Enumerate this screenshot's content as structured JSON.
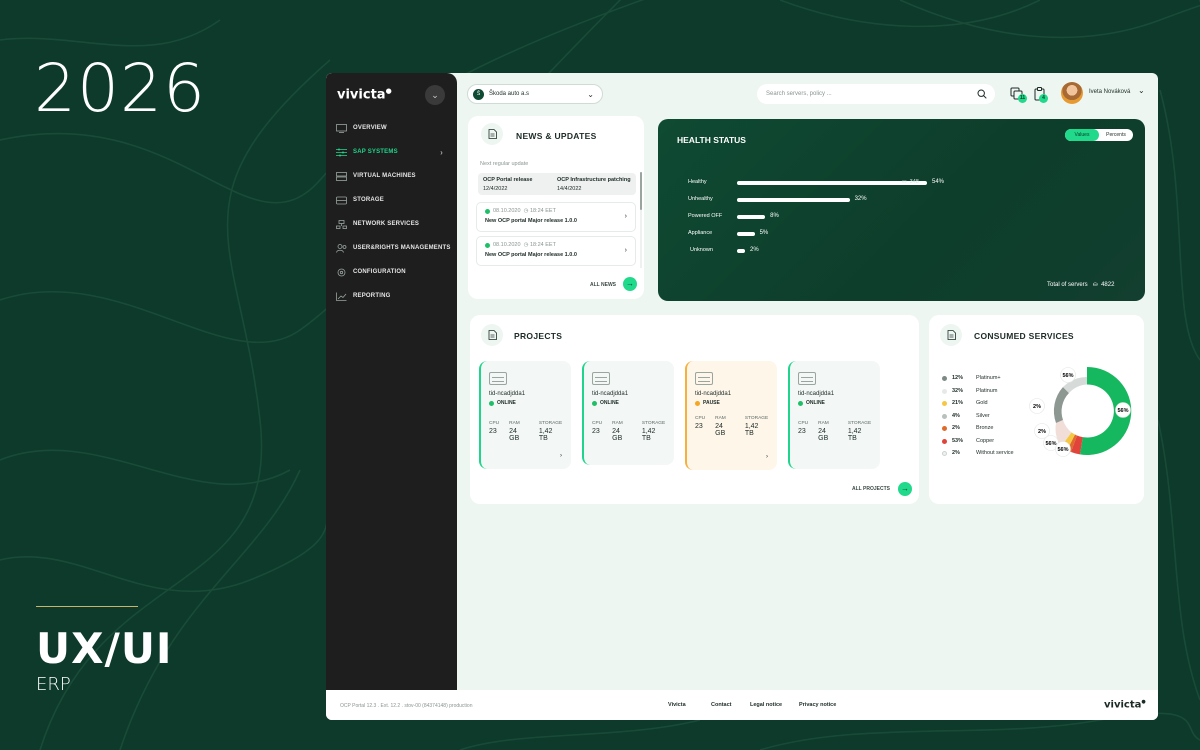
{
  "promo": {
    "year": "2026",
    "title": "UX/UI",
    "subtitle": "ERP"
  },
  "app": {
    "logo": "vivicta",
    "sidebar": {
      "items": [
        {
          "label": "OVERVIEW",
          "icon": "monitor-icon"
        },
        {
          "label": "SAP SYSTEMS",
          "icon": "sliders-icon",
          "active": true
        },
        {
          "label": "VIRTUAL MACHINES",
          "icon": "server-icon"
        },
        {
          "label": "STORAGE",
          "icon": "storage-icon"
        },
        {
          "label": "NETWORK SERVICES",
          "icon": "network-icon"
        },
        {
          "label": "USER&RIGHTS MANAGEMENTS",
          "icon": "users-icon"
        },
        {
          "label": "CONFIGURATION",
          "icon": "gear-icon"
        },
        {
          "label": "REPORTING",
          "icon": "chart-icon"
        }
      ]
    },
    "topbar": {
      "company": "Škoda auto a.s",
      "search_placeholder": "Search servers, policy ...",
      "notif_badge_1": "11",
      "notif_badge_2": "4",
      "user_name": "Iveta Nováková"
    },
    "news": {
      "title": "NEWS & UPDATES",
      "subtitle": "Next regular update",
      "tabs": [
        {
          "title": "OCP Portal release",
          "date": "12/4/2022"
        },
        {
          "title": "OCP Infrastructure patching",
          "date": "14/4/2022"
        }
      ],
      "items": [
        {
          "date": "08.10.2020",
          "time": "18:24 EET",
          "title": "New OCP portal Major release 1.0.0"
        },
        {
          "date": "08.10.2020",
          "time": "18:24 EET",
          "title": "New OCP portal Major release 1.0.0"
        }
      ],
      "all_link": "ALL NEWS"
    },
    "health": {
      "title": "HEALTH STATUS",
      "toggle": {
        "values": "Values",
        "percents": "Percents",
        "selected": "Values"
      },
      "rows": [
        {
          "label": "Healthy",
          "percent": 54,
          "percent_label": "54%",
          "servers": "348"
        },
        {
          "label": "Unhealthy",
          "percent": 32,
          "percent_label": "32%"
        },
        {
          "label": "Powered OFF",
          "percent": 8,
          "percent_label": "8%"
        },
        {
          "label": "Appliance",
          "percent": 5,
          "percent_label": "5%"
        },
        {
          "label": "Unknown",
          "percent": 2,
          "percent_label": "2%"
        }
      ],
      "total_label": "Total of servers",
      "total_value": "4822"
    },
    "projects": {
      "title": "PROJECTS",
      "items": [
        {
          "name": "tid-ncadjdda1",
          "status": "ONLINE",
          "cpu": "23",
          "ram": "24 GB",
          "storage": "1,42 TB"
        },
        {
          "name": "tid-ncadjdda1",
          "status": "ONLINE",
          "cpu": "23",
          "ram": "24 GB",
          "storage": "1,42 TB"
        },
        {
          "name": "tid-ncadjdda1",
          "status": "PAUSE",
          "cpu": "23",
          "ram": "24 GB",
          "storage": "1,42 TB"
        },
        {
          "name": "tid-ncadjdda1",
          "status": "ONLINE",
          "cpu": "23",
          "ram": "24 GB",
          "storage": "1,42 TB"
        }
      ],
      "labels": {
        "cpu": "CPU",
        "ram": "RAM",
        "storage": "STORAGE"
      },
      "all_link": "ALL PROJECTS"
    },
    "consumed": {
      "title": "CONSUMED SERVICES",
      "legend": [
        {
          "pct": "12%",
          "label": "Platinum+",
          "color": "#7d8a84"
        },
        {
          "pct": "32%",
          "label": "Platinum",
          "color": "#e6e9e8"
        },
        {
          "pct": "21%",
          "label": "Gold",
          "color": "#f5c742"
        },
        {
          "pct": "4%",
          "label": "Silver",
          "color": "#b9c0bd"
        },
        {
          "pct": "2%",
          "label": "Bronze",
          "color": "#e06a2c"
        },
        {
          "pct": "53%",
          "label": "Copper",
          "color": "#e0443a"
        },
        {
          "pct": "2%",
          "label": "Without service",
          "color": "#eef1ef"
        }
      ],
      "donut_labels": [
        "56%",
        "56%",
        "2%",
        "2%",
        "56%",
        "56%"
      ]
    },
    "footer": {
      "version": "OCP Portal 12.3 . Ext. 12.2 . stov-00 (84374148) production",
      "links": [
        "Vivicta",
        "Contact",
        "Legal notice",
        "Privacy notice"
      ],
      "logo": "vivicta"
    }
  }
}
